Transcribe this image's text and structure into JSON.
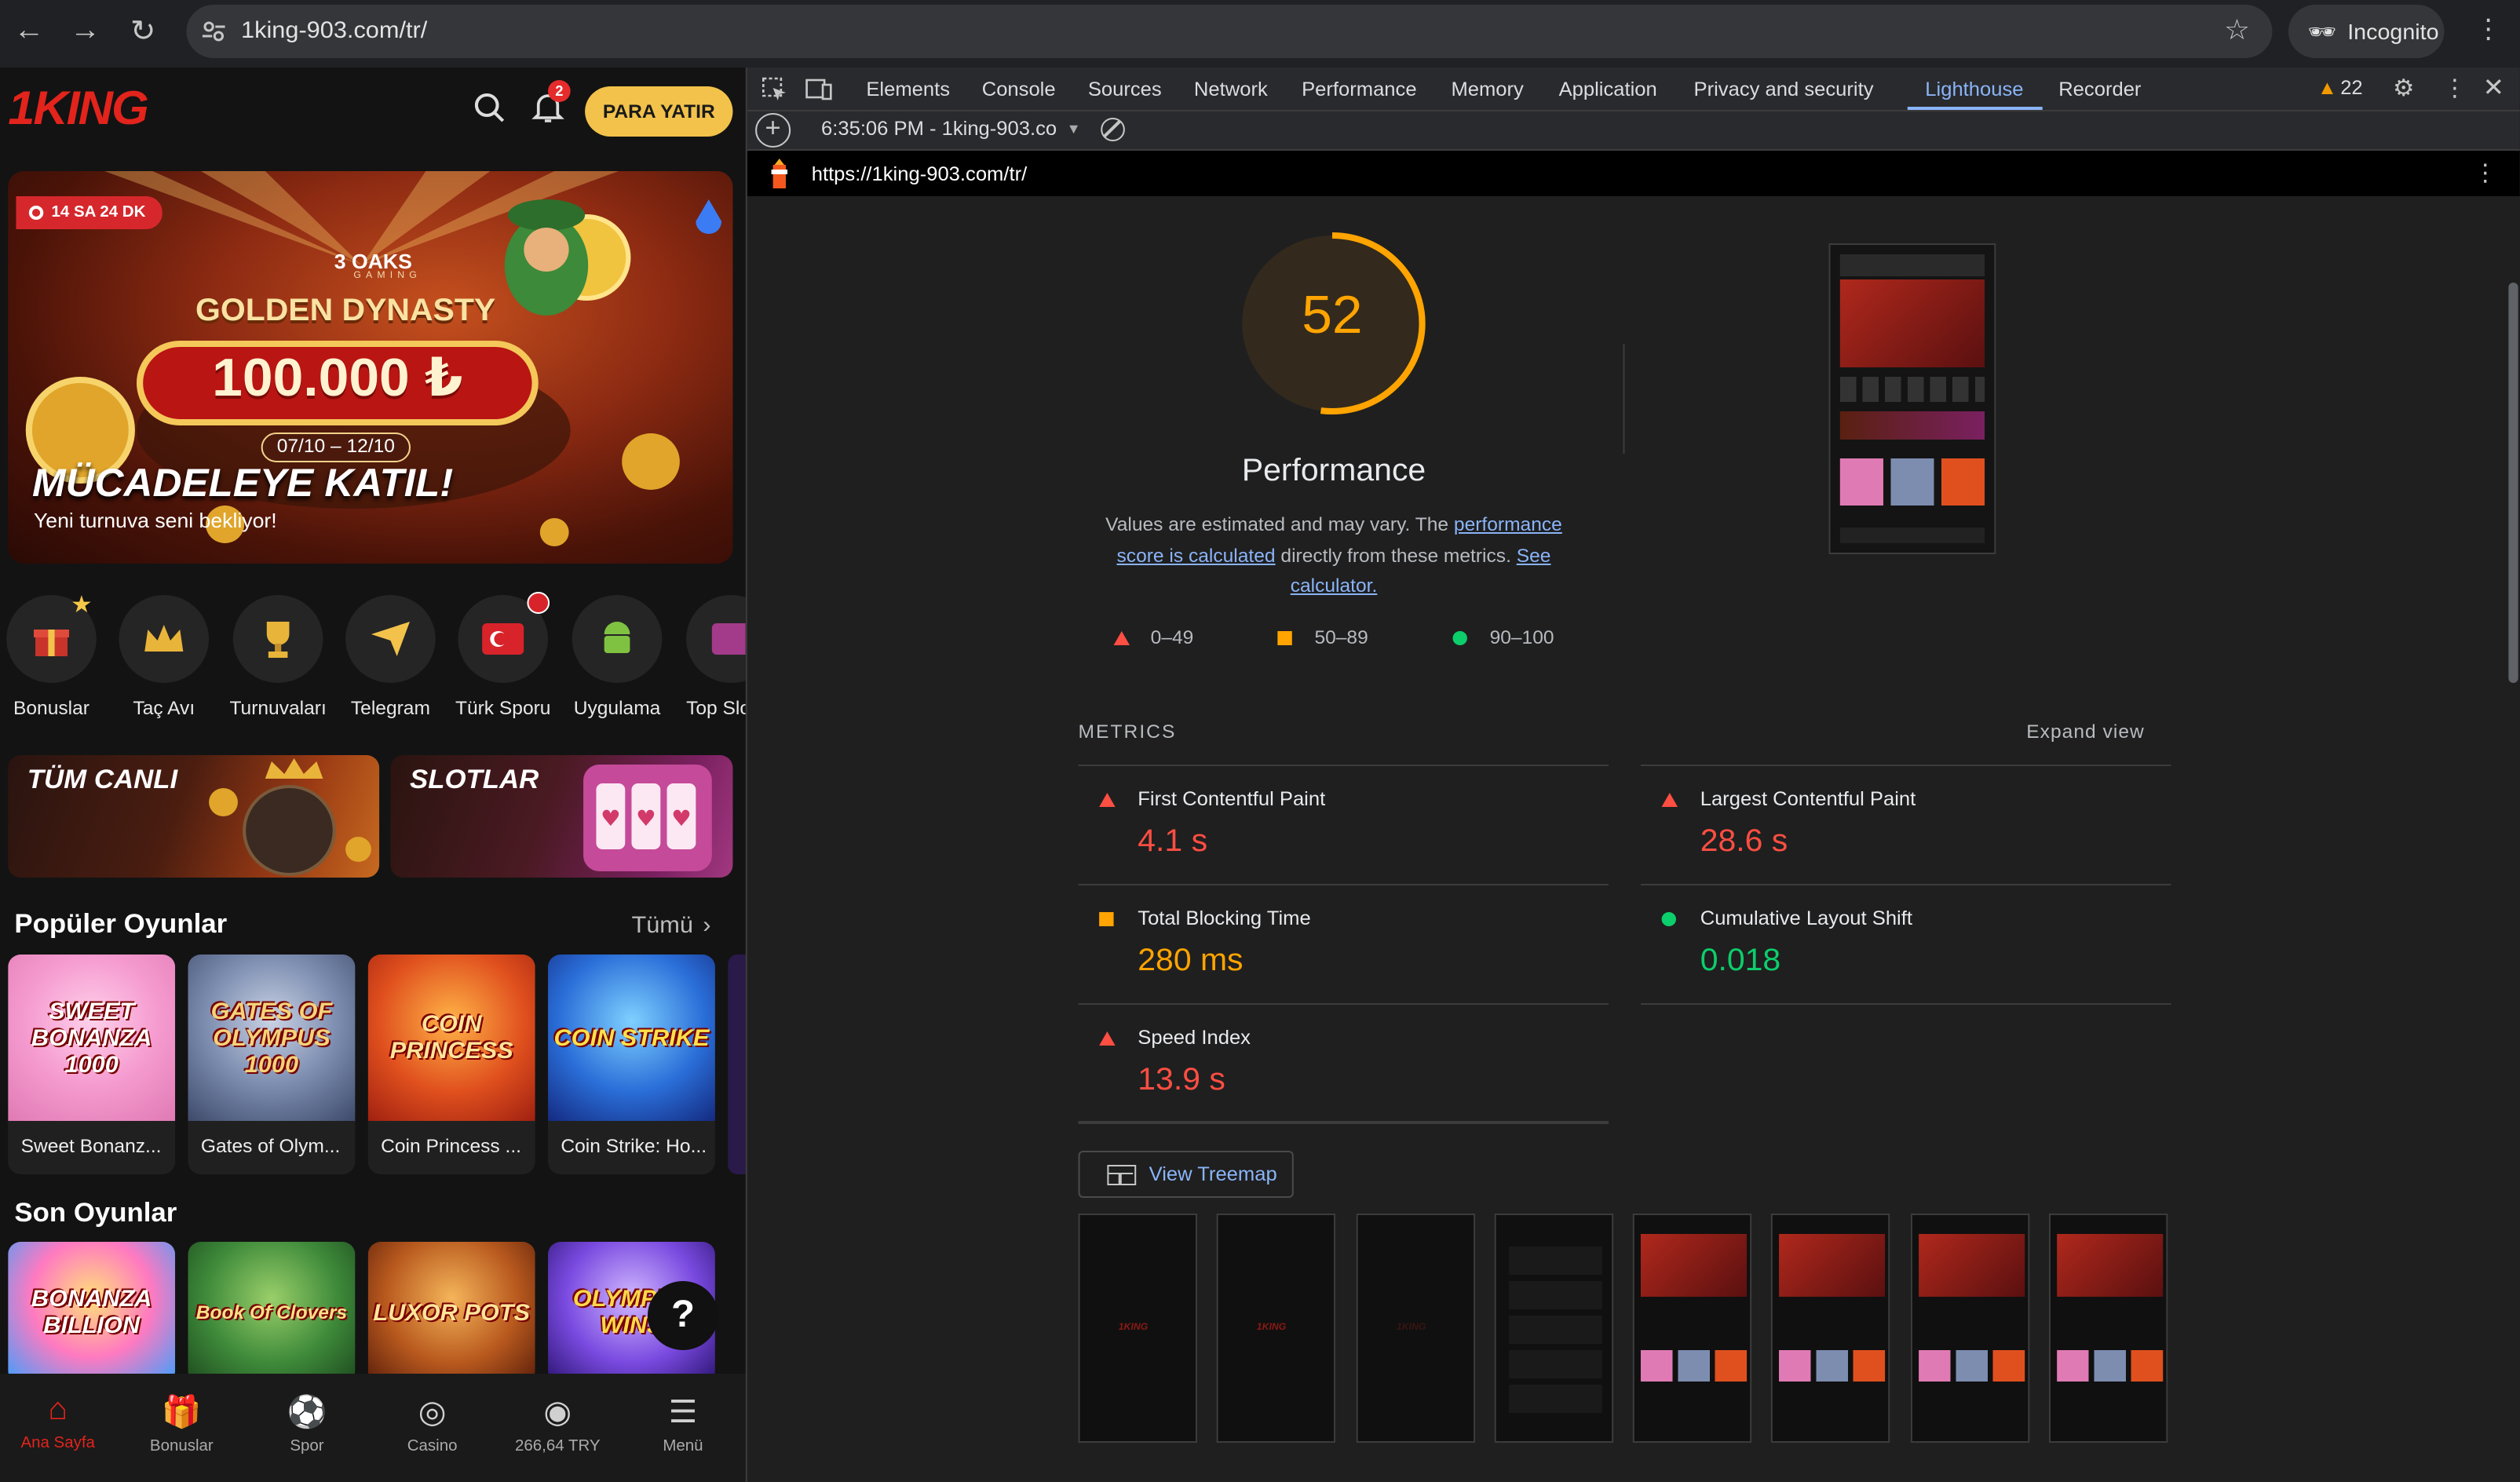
{
  "browser": {
    "url": "1king-903.com/tr/",
    "incognito_label": "Incognito"
  },
  "site": {
    "logo": "1KING",
    "deposit_button": "PARA YATIR",
    "notification_count": "2",
    "banner": {
      "timer": "14 SA 24 DK",
      "brand": "3 OAKS",
      "brand_sub": "GAMING",
      "title": "GOLDEN DYNASTY",
      "prize": "100.000 ₺",
      "dates": "07/10 – 12/10",
      "headline": "MÜCADELEYE KATIL!",
      "subline": "Yeni turnuva seni bekliyor!"
    },
    "categories": [
      {
        "label": "Bonuslar",
        "icon": "gift-icon"
      },
      {
        "label": "Taç Avı",
        "icon": "crown-icon"
      },
      {
        "label": "Turnuvaları",
        "icon": "trophy-icon"
      },
      {
        "label": "Telegram",
        "icon": "telegram-icon"
      },
      {
        "label": "Türk Sporu",
        "icon": "turkey-flag-icon"
      },
      {
        "label": "Uygulama",
        "icon": "android-icon"
      },
      {
        "label": "Top Slo",
        "icon": "top-slots-icon"
      }
    ],
    "promos": [
      {
        "title": "TÜM CANLI"
      },
      {
        "title": "SLOTLAR"
      }
    ],
    "popular": {
      "title": "Popüler Oyunlar",
      "see_all": "Tümü",
      "games": [
        {
          "art": "SWEET BONANZA 1000",
          "label": "Sweet Bonanz..."
        },
        {
          "art": "GATES OF OLYMPUS 1000",
          "label": "Gates of Olym..."
        },
        {
          "art": "COIN PRINCESS",
          "label": "Coin Princess ..."
        },
        {
          "art": "COIN STRIKE",
          "label": "Coin Strike: Ho..."
        }
      ]
    },
    "recent": {
      "title": "Son Oyunlar",
      "games": [
        {
          "art": "BONANZA BILLION"
        },
        {
          "art": "Book Of Clovers"
        },
        {
          "art": "LUXOR POTS"
        },
        {
          "art": "OLYMPUS WINS"
        }
      ]
    },
    "help_button": "?",
    "bottom_nav": [
      {
        "label": "Ana Sayfa",
        "icon": "home-icon"
      },
      {
        "label": "Bonuslar",
        "icon": "gift-icon"
      },
      {
        "label": "Spor",
        "icon": "football-icon"
      },
      {
        "label": "Casino",
        "icon": "casino-chip-icon"
      },
      {
        "label": "266,64 TRY",
        "icon": "user-icon"
      },
      {
        "label": "Menü",
        "icon": "menu-icon"
      }
    ]
  },
  "devtools": {
    "tabs": [
      "Elements",
      "Console",
      "Sources",
      "Network",
      "Performance",
      "Memory",
      "Application",
      "Privacy and security",
      "Lighthouse",
      "Recorder"
    ],
    "active_tab": "Lighthouse",
    "warning_count": "22",
    "report_selector": "6:35:06 PM - 1king-903.co",
    "report_url": "https://1king-903.com/tr/",
    "score": 52,
    "score_title": "Performance",
    "desc_prefix": "Values are estimated and may vary. The",
    "desc_link1": "performance score is calculated",
    "desc_mid": "directly from these metrics.",
    "desc_link2": "See calculator.",
    "legend": [
      "0–49",
      "50–89",
      "90–100"
    ],
    "metrics_heading": "METRICS",
    "expand_view": "Expand view",
    "metrics": [
      {
        "label": "First Contentful Paint",
        "value": "4.1 s",
        "rating": "fail"
      },
      {
        "label": "Largest Contentful Paint",
        "value": "28.6 s",
        "rating": "fail"
      },
      {
        "label": "Total Blocking Time",
        "value": "280 ms",
        "rating": "average"
      },
      {
        "label": "Cumulative Layout Shift",
        "value": "0.018",
        "rating": "pass"
      },
      {
        "label": "Speed Index",
        "value": "13.9 s",
        "rating": "fail"
      }
    ],
    "view_treemap": "View Treemap",
    "colors": {
      "fail": "#ff4e42",
      "average": "#ffa400",
      "pass": "#0cce6b",
      "link": "#8ab4f8"
    }
  }
}
